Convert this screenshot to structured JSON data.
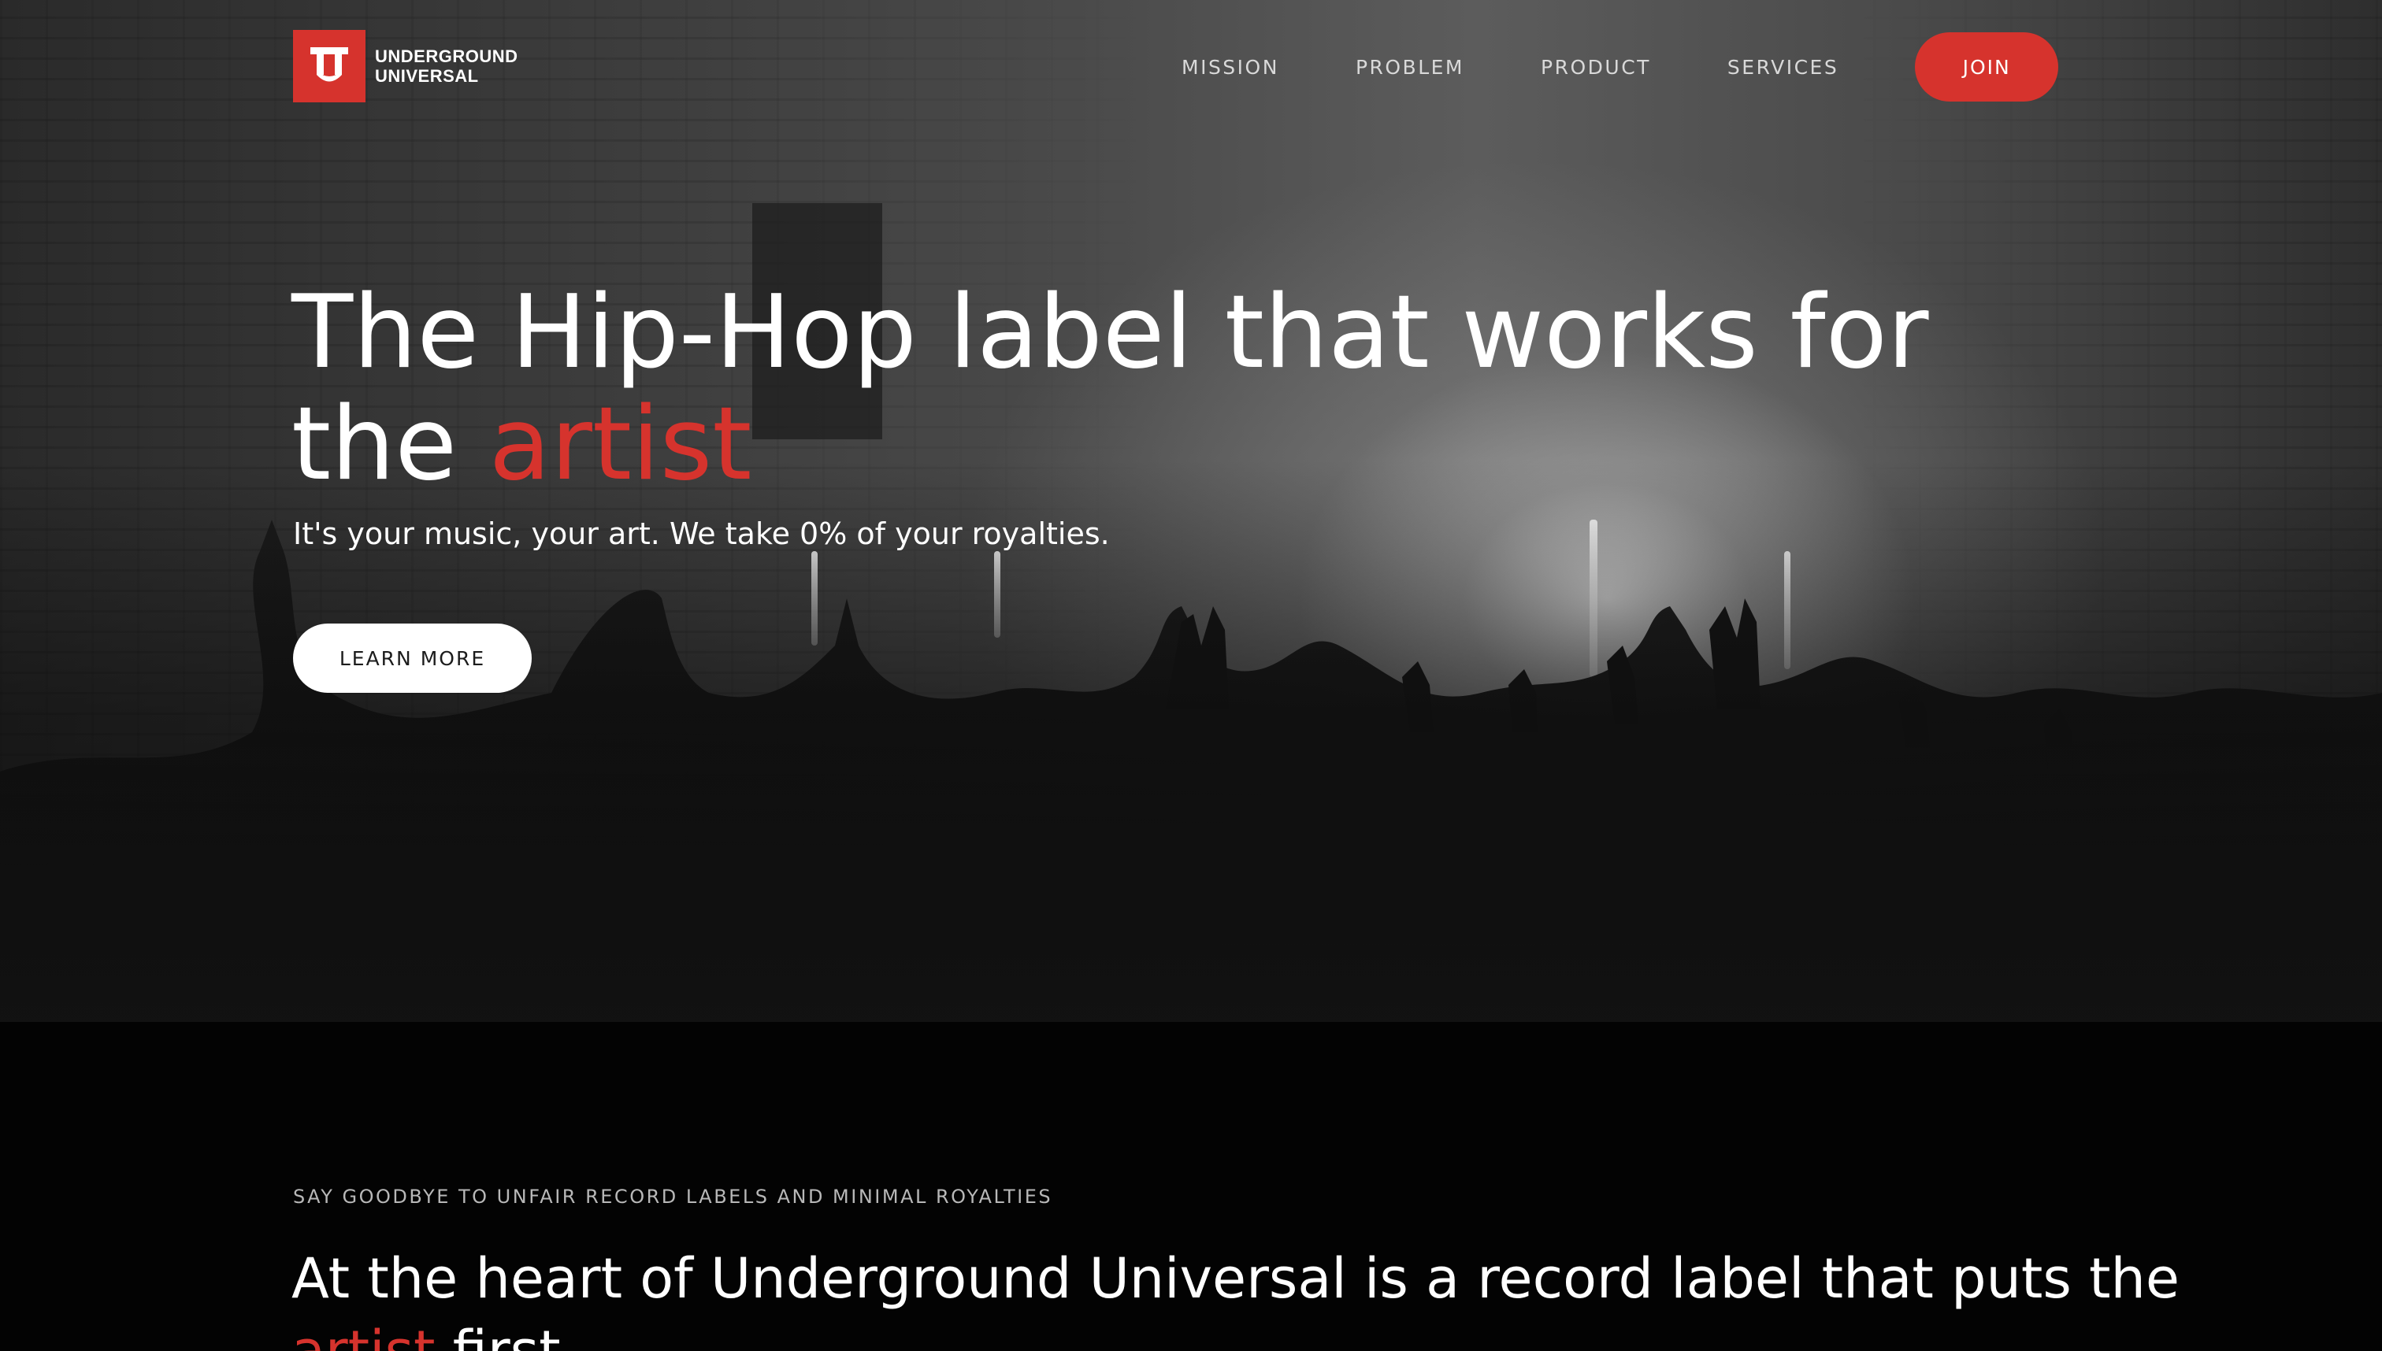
{
  "brand": {
    "name_line1": "UNDERGROUND",
    "name_line2": "UNIVERSAL",
    "logo_icon": "u-monogram-logo",
    "accent_color": "#d6332d"
  },
  "nav": {
    "items": [
      {
        "label": "MISSION"
      },
      {
        "label": "PROBLEM"
      },
      {
        "label": "PRODUCT"
      },
      {
        "label": "SERVICES"
      }
    ],
    "join_label": "JOIN"
  },
  "hero": {
    "title_main": "The Hip-Hop label that works for the ",
    "title_accent": "artist",
    "subtitle": "It's your music, your art. We take 0% of your royalties.",
    "cta_label": "LEARN MORE",
    "background_image": "black-and-white concert crowd with raised hands"
  },
  "mission": {
    "eyebrow": "SAY GOODBYE TO UNFAIR RECORD LABELS AND MINIMAL ROYALTIES",
    "heading_main": "At the heart of Underground Universal is a record label that puts the ",
    "heading_accent": "artist",
    "heading_end": " first."
  }
}
